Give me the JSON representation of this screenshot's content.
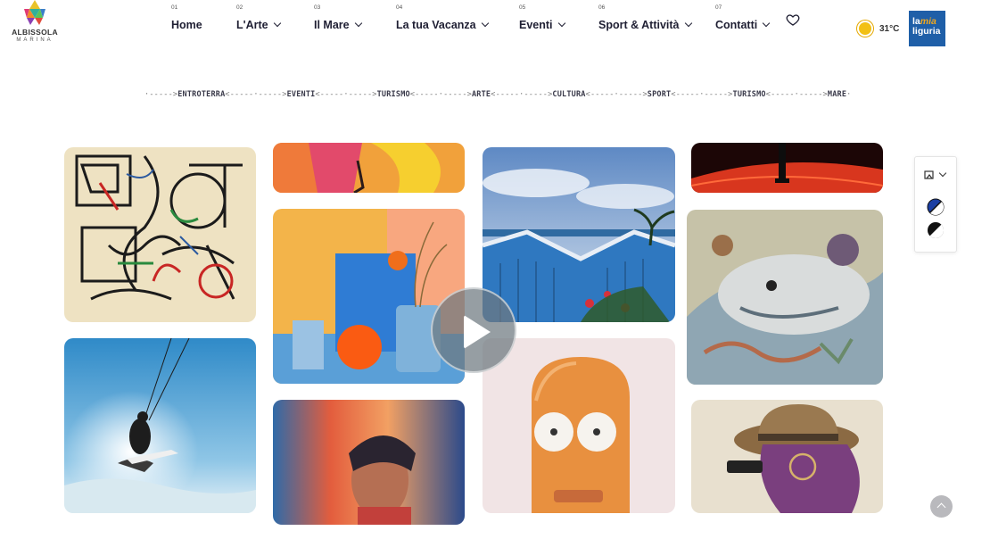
{
  "brand": {
    "name": "ALBISSOLA",
    "sub": "MARINA"
  },
  "nav": [
    {
      "num": "01",
      "label": "Home",
      "dropdown": false
    },
    {
      "num": "02",
      "label": "L'Arte",
      "dropdown": true
    },
    {
      "num": "03",
      "label": "Il Mare",
      "dropdown": true
    },
    {
      "num": "04",
      "label": "La tua Vacanza",
      "dropdown": true
    },
    {
      "num": "05",
      "label": "Eventi",
      "dropdown": true
    },
    {
      "num": "06",
      "label": "Sport & Attività",
      "dropdown": true
    },
    {
      "num": "07",
      "label": "Contatti",
      "dropdown": true
    }
  ],
  "weather": {
    "temp": "31°C",
    "icon": "sun-icon"
  },
  "partner": {
    "line1a": "la",
    "line1b": "mia",
    "line2": "liguria"
  },
  "ticker": [
    "ENTROTERRA",
    "EVENTI",
    "TURISMO",
    "ARTE",
    "CULTURA",
    "SPORT",
    "TURISMO",
    "MARE"
  ],
  "gallery": [
    {
      "name": "abstract-painting",
      "icon": "image"
    },
    {
      "name": "kitesurfer",
      "icon": "image"
    },
    {
      "name": "fashion-yellow",
      "icon": "image"
    },
    {
      "name": "pastel-still-life",
      "icon": "image"
    },
    {
      "name": "blurred-portrait",
      "icon": "image"
    },
    {
      "name": "beach-cabins",
      "icon": "image"
    },
    {
      "name": "orange-character",
      "icon": "image"
    },
    {
      "name": "red-figure",
      "icon": "image"
    },
    {
      "name": "sea-mural",
      "icon": "image"
    },
    {
      "name": "purple-hat-character",
      "icon": "image"
    }
  ],
  "colors": {
    "accent": "#1f5fa8",
    "sun": "#f2c014",
    "text": "#1f1f33"
  }
}
